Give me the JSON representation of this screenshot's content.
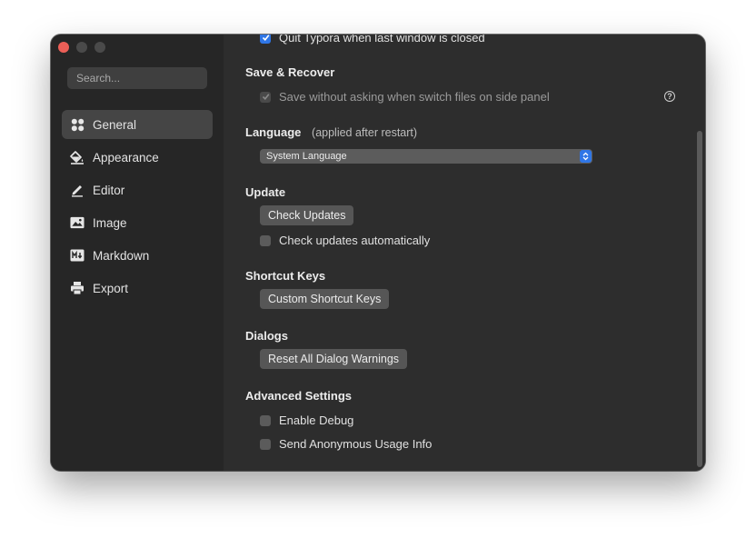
{
  "sidebar": {
    "search_placeholder": "Search...",
    "items": [
      {
        "label": "General",
        "icon": "grid-icon",
        "active": true
      },
      {
        "label": "Appearance",
        "icon": "paint-bucket-icon"
      },
      {
        "label": "Editor",
        "icon": "pencil-icon"
      },
      {
        "label": "Image",
        "icon": "image-icon"
      },
      {
        "label": "Markdown",
        "icon": "markdown-icon"
      },
      {
        "label": "Export",
        "icon": "printer-icon"
      }
    ]
  },
  "main": {
    "quit_on_close": {
      "label": "Quit Typora when last window is closed",
      "checked": true
    },
    "save_recover": {
      "title": "Save & Recover",
      "save_without_asking": {
        "label": "Save without asking when switch files on side panel",
        "checked": true,
        "disabled": true
      },
      "help": "?"
    },
    "language": {
      "title": "Language",
      "note": "(applied after restart)",
      "selected": "System Language"
    },
    "update": {
      "title": "Update",
      "check_button": "Check Updates",
      "auto_check": {
        "label": "Check updates automatically",
        "checked": false
      }
    },
    "shortcut_keys": {
      "title": "Shortcut Keys",
      "button": "Custom Shortcut Keys"
    },
    "dialogs": {
      "title": "Dialogs",
      "button": "Reset All Dialog Warnings"
    },
    "advanced": {
      "title": "Advanced Settings",
      "enable_debug": {
        "label": "Enable Debug",
        "checked": false
      },
      "usage_info": {
        "label": "Send Anonymous Usage Info",
        "checked": false
      }
    }
  },
  "colors": {
    "accent": "#2f76e6",
    "close": "#ec5f57",
    "sidebar_bg": "#262626",
    "main_bg": "#2d2d2d"
  }
}
